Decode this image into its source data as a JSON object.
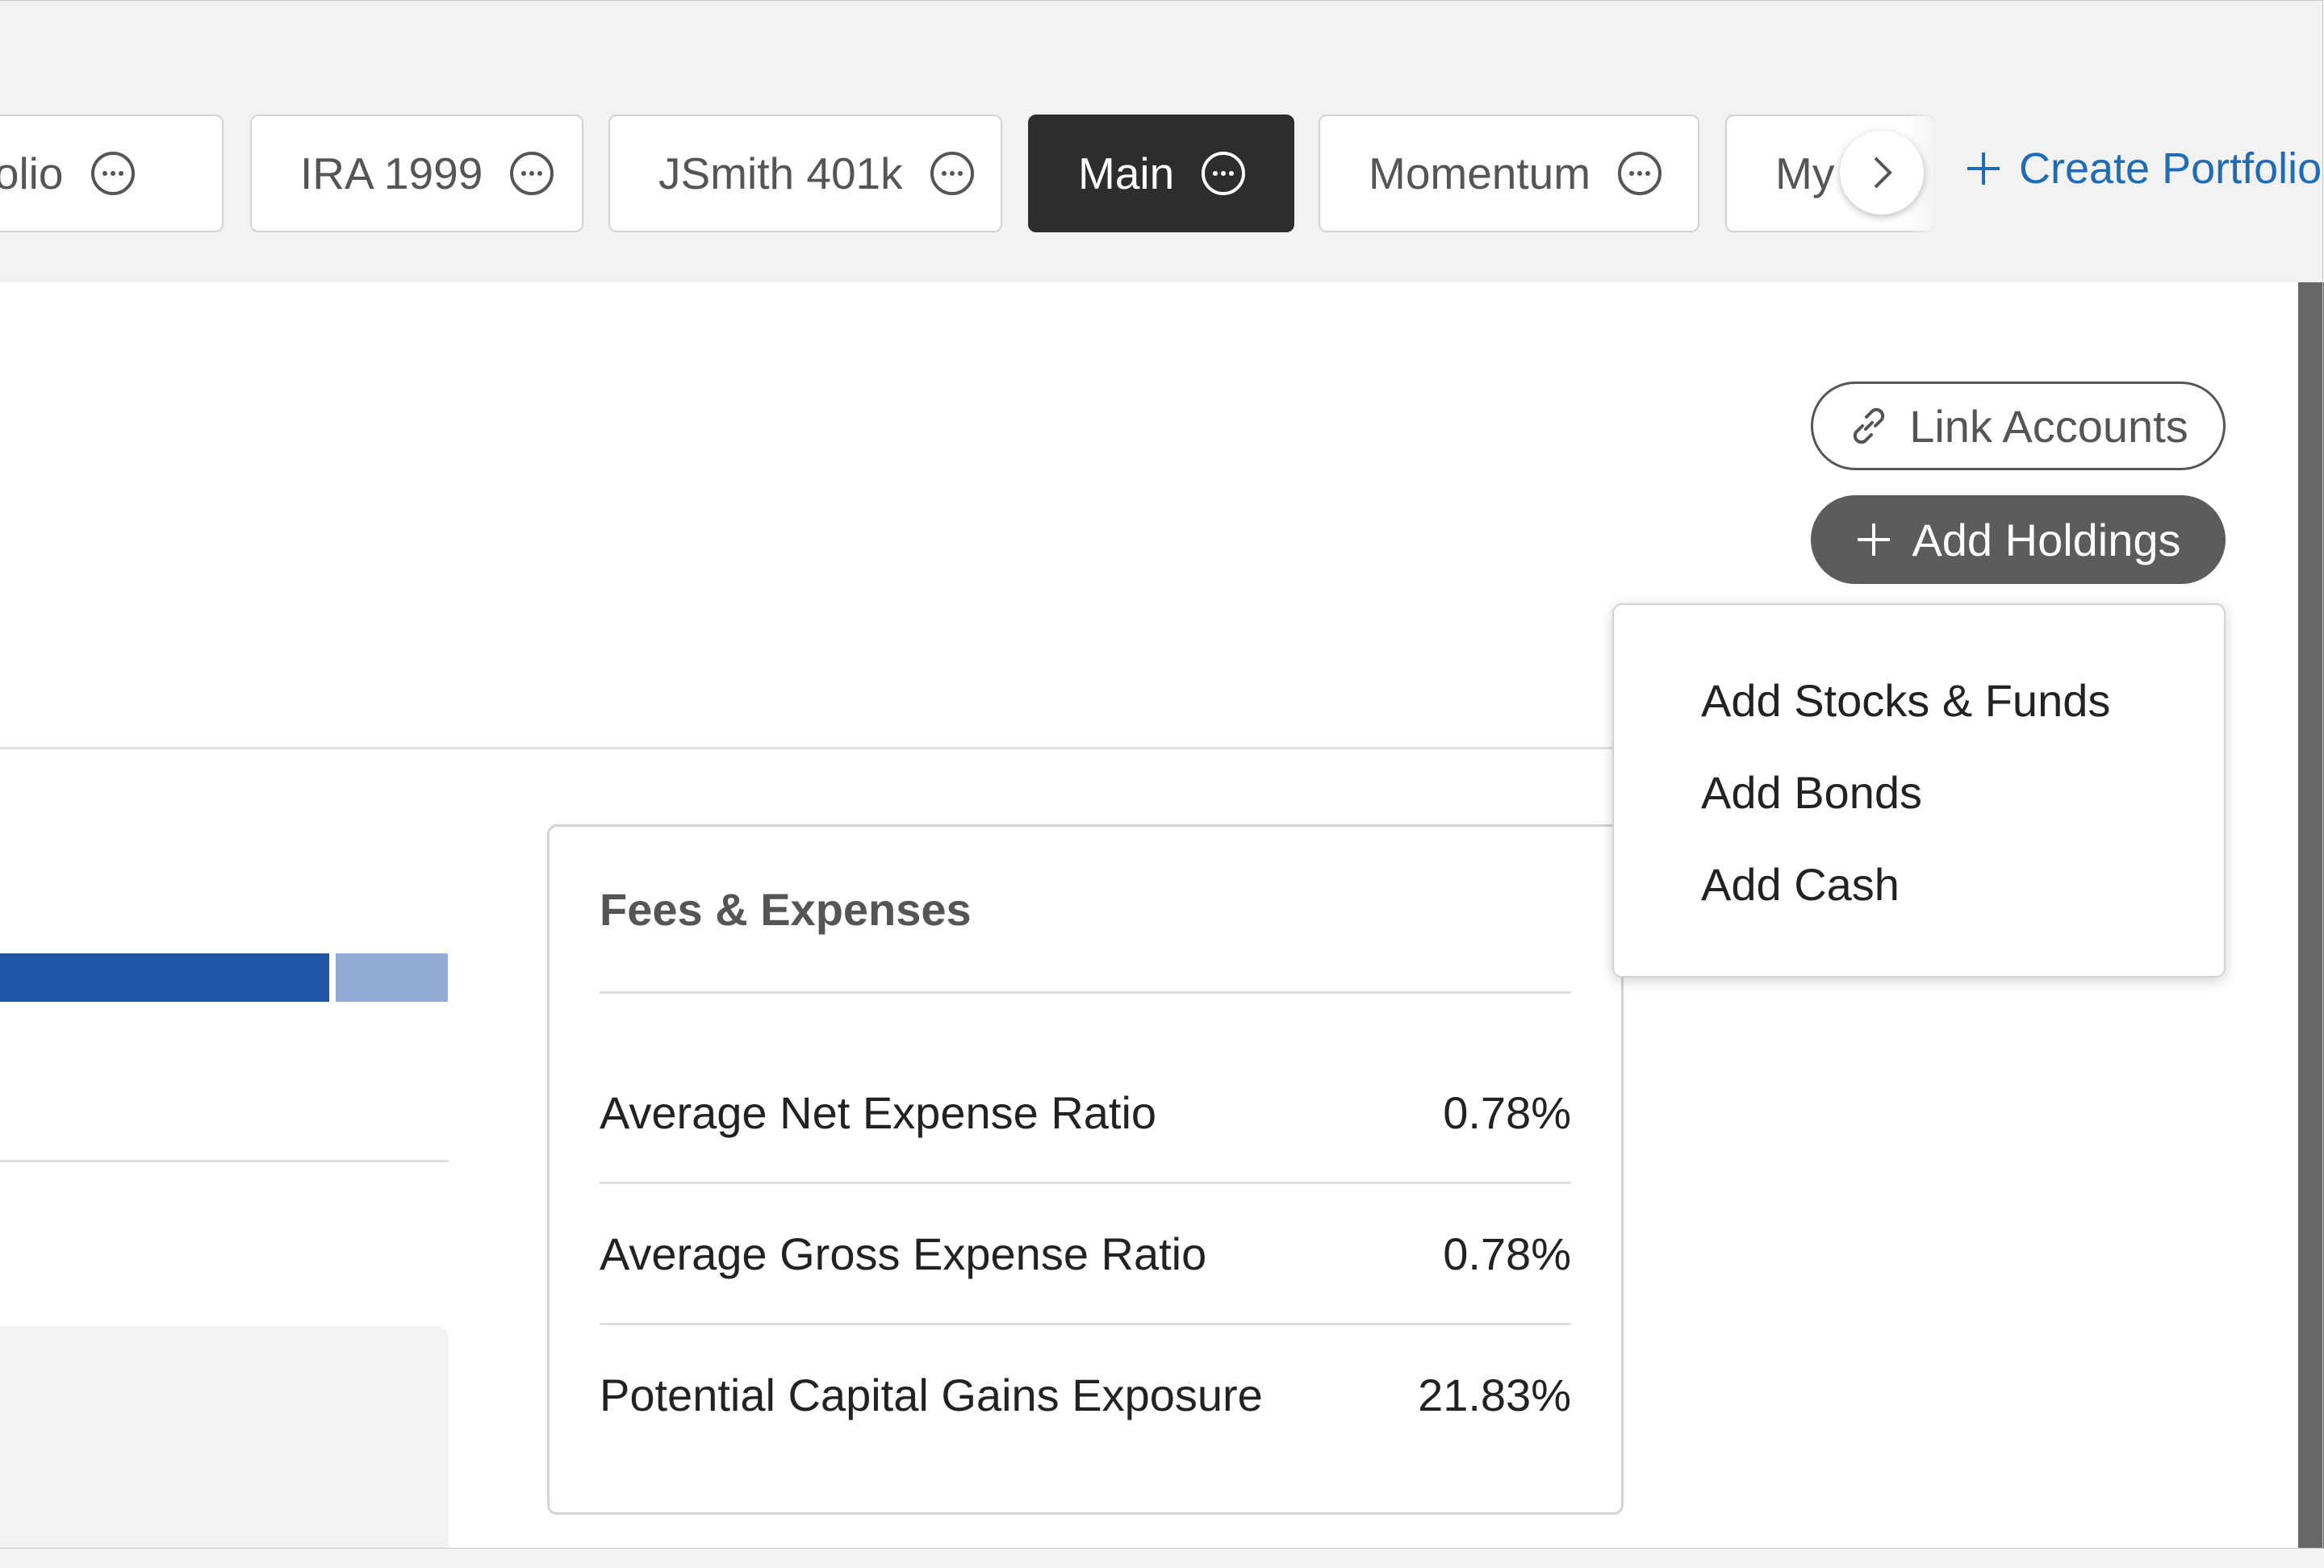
{
  "tabs": [
    {
      "label": "rtfolio",
      "active": false
    },
    {
      "label": "IRA 1999",
      "active": false
    },
    {
      "label": "JSmith 401k",
      "active": false
    },
    {
      "label": "Main",
      "active": true
    },
    {
      "label": "Momentum",
      "active": false
    },
    {
      "label": "My",
      "active": false
    }
  ],
  "create_portfolio": "Create Portfolio",
  "actions": {
    "link_accounts": "Link Accounts",
    "add_holdings": "Add Holdings"
  },
  "dropdown": {
    "items": [
      "Add Stocks & Funds",
      "Add Bonds",
      "Add Cash"
    ]
  },
  "fees_card": {
    "title": "Fees & Expenses",
    "rows": [
      {
        "label": "Average Net Expense Ratio",
        "value": "0.78%"
      },
      {
        "label": "Average Gross Expense Ratio",
        "value": "0.78%"
      },
      {
        "label": "Potential Capital Gains Exposure",
        "value": "21.83%"
      }
    ]
  },
  "colors": {
    "active_tab": "#2d2d2d",
    "link_blue": "#1f6bb5",
    "bar_dark": "#2256a6",
    "bar_light": "#93acd6",
    "add_button": "#5c5c5c"
  }
}
